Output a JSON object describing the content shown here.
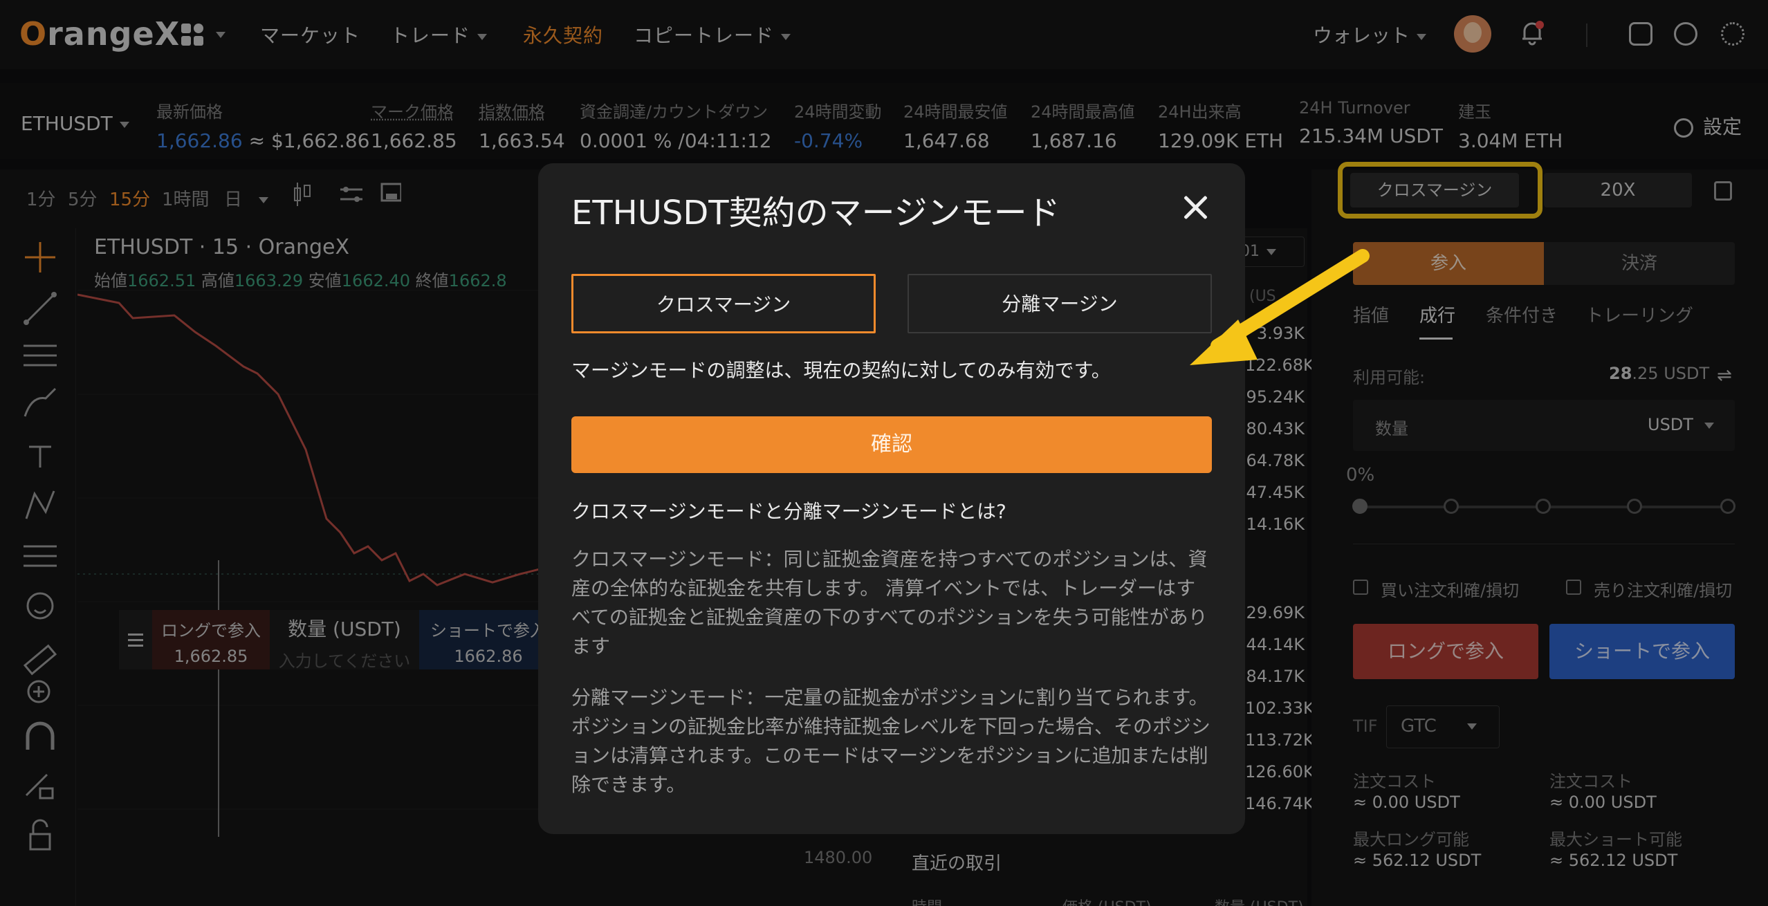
{
  "brand": {
    "logo_o": "O",
    "logo_rest": "rangeX",
    "accent": "#f08a2c",
    "highlight": "#f5c518"
  },
  "nav": {
    "market": "マーケット",
    "trade": "トレード",
    "perpetual": "永久契約",
    "copy_trade": "コピートレード",
    "wallet": "ウォレット"
  },
  "ticker": {
    "symbol": "ETHUSDT",
    "last_price_label": "最新価格",
    "last_price": "1,662.86",
    "last_price_usd": "≈ $1,662.86",
    "mark_price_label": "マーク価格",
    "mark_price": "1,662.85",
    "index_price_label": "指数価格",
    "index_price": "1,663.54",
    "funding_label": "資金調達/カウントダウン",
    "funding": "0.0001 % /04:11:12",
    "change_label": "24時間変動",
    "change": "-0.74%",
    "low_label": "24時間最安値",
    "low": "1,647.68",
    "high_label": "24時間最高値",
    "high": "1,687.16",
    "volume_label": "24H出来高",
    "volume": "129.09K ETH",
    "turnover_label": "24H Turnover",
    "turnover": "215.34M USDT",
    "oi_label": "建玉",
    "oi": "3.04M ETH",
    "settings": "設定"
  },
  "timeframes": [
    "1分",
    "5分",
    "15分",
    "1時間",
    "日"
  ],
  "chart": {
    "title": "ETHUSDT · 15 · OrangeX",
    "open_label": "始値",
    "open": "1662.51",
    "high_label": "高値",
    "high": "1663.29",
    "low_label": "安値",
    "low": "1662.40",
    "close_label": "終値",
    "close": "1662.8",
    "price_axis_label": "1480.00"
  },
  "trade_strip": {
    "long_label": "ロングで参入",
    "long_price": "1,662.85",
    "qty_label": "数量 (USDT)",
    "qty_placeholder": "入力してください",
    "short_label": "ショートで参入",
    "short_price": "1662.86"
  },
  "orderbook": {
    "dropdown": "01",
    "unit_hint": "(US",
    "asks": [
      "3.93K",
      "122.68K",
      "95.24K",
      "80.43K",
      "64.78K",
      "47.45K",
      "14.16K"
    ],
    "bids": [
      "29.69K",
      "44.14K",
      "84.17K",
      "102.33K",
      "113.72K",
      "126.60K",
      "146.74K"
    ],
    "recent_trades": "直近の取引",
    "hdr_time": "時間",
    "hdr_price": "価格 (USDT)",
    "hdr_qty": "数量 (USDT)"
  },
  "trade_panel": {
    "margin_mode": "クロスマージン",
    "leverage": "20X",
    "open": "参入",
    "close": "決済",
    "order_tabs": [
      "指値",
      "成行",
      "条件付き",
      "トレーリング"
    ],
    "available_label": "利用可能:",
    "available_int": "28",
    "available_dec": ".25 USDT",
    "qty_placeholder": "数量",
    "qty_unit": "USDT",
    "percent": "0%",
    "buy_tpsl": "買い注文利確/損切",
    "sell_tpsl": "売り注文利確/損切",
    "long_button": "ロングで参入",
    "short_button": "ショートで参入",
    "tif_label": "TIF",
    "tif_value": "GTC",
    "cost_label": "注文コスト",
    "cost_long": "≈ 0.00 USDT",
    "cost_short": "≈ 0.00 USDT",
    "max_long_label": "最大ロング可能",
    "max_long": "≈ 562.12 USDT",
    "max_short_label": "最大ショート可能",
    "max_short": "≈ 562.12 USDT"
  },
  "modal": {
    "title": "ETHUSDT契約のマージンモード",
    "option_cross": "クロスマージン",
    "option_isolated": "分離マージン",
    "note": "マージンモードの調整は、現在の契約に対してのみ有効です。",
    "confirm": "確認",
    "question": "クロスマージンモードと分離マージンモードとは?",
    "cross_line1": "クロスマージンモード：同じ証拠金資産を持つすべてのポジションは、資",
    "cross_line2": "産の全体的な証拠金を共有します。 清算イベントでは、トレーダーはす",
    "cross_line3": "べての証拠金と証拠金資産の下のすべてのポジションを失う可能性があり",
    "cross_line4": "ます",
    "iso_line1": "分離マージンモード：一定量の証拠金がポジションに割り当てられます。",
    "iso_line2": "ポジションの証拠金比率が維持証拠金レベルを下回った場合、そのポジシ",
    "iso_line3": "ョンは清算されます。このモードはマージンをポジションに追加または削",
    "iso_line4": "除できます。"
  }
}
